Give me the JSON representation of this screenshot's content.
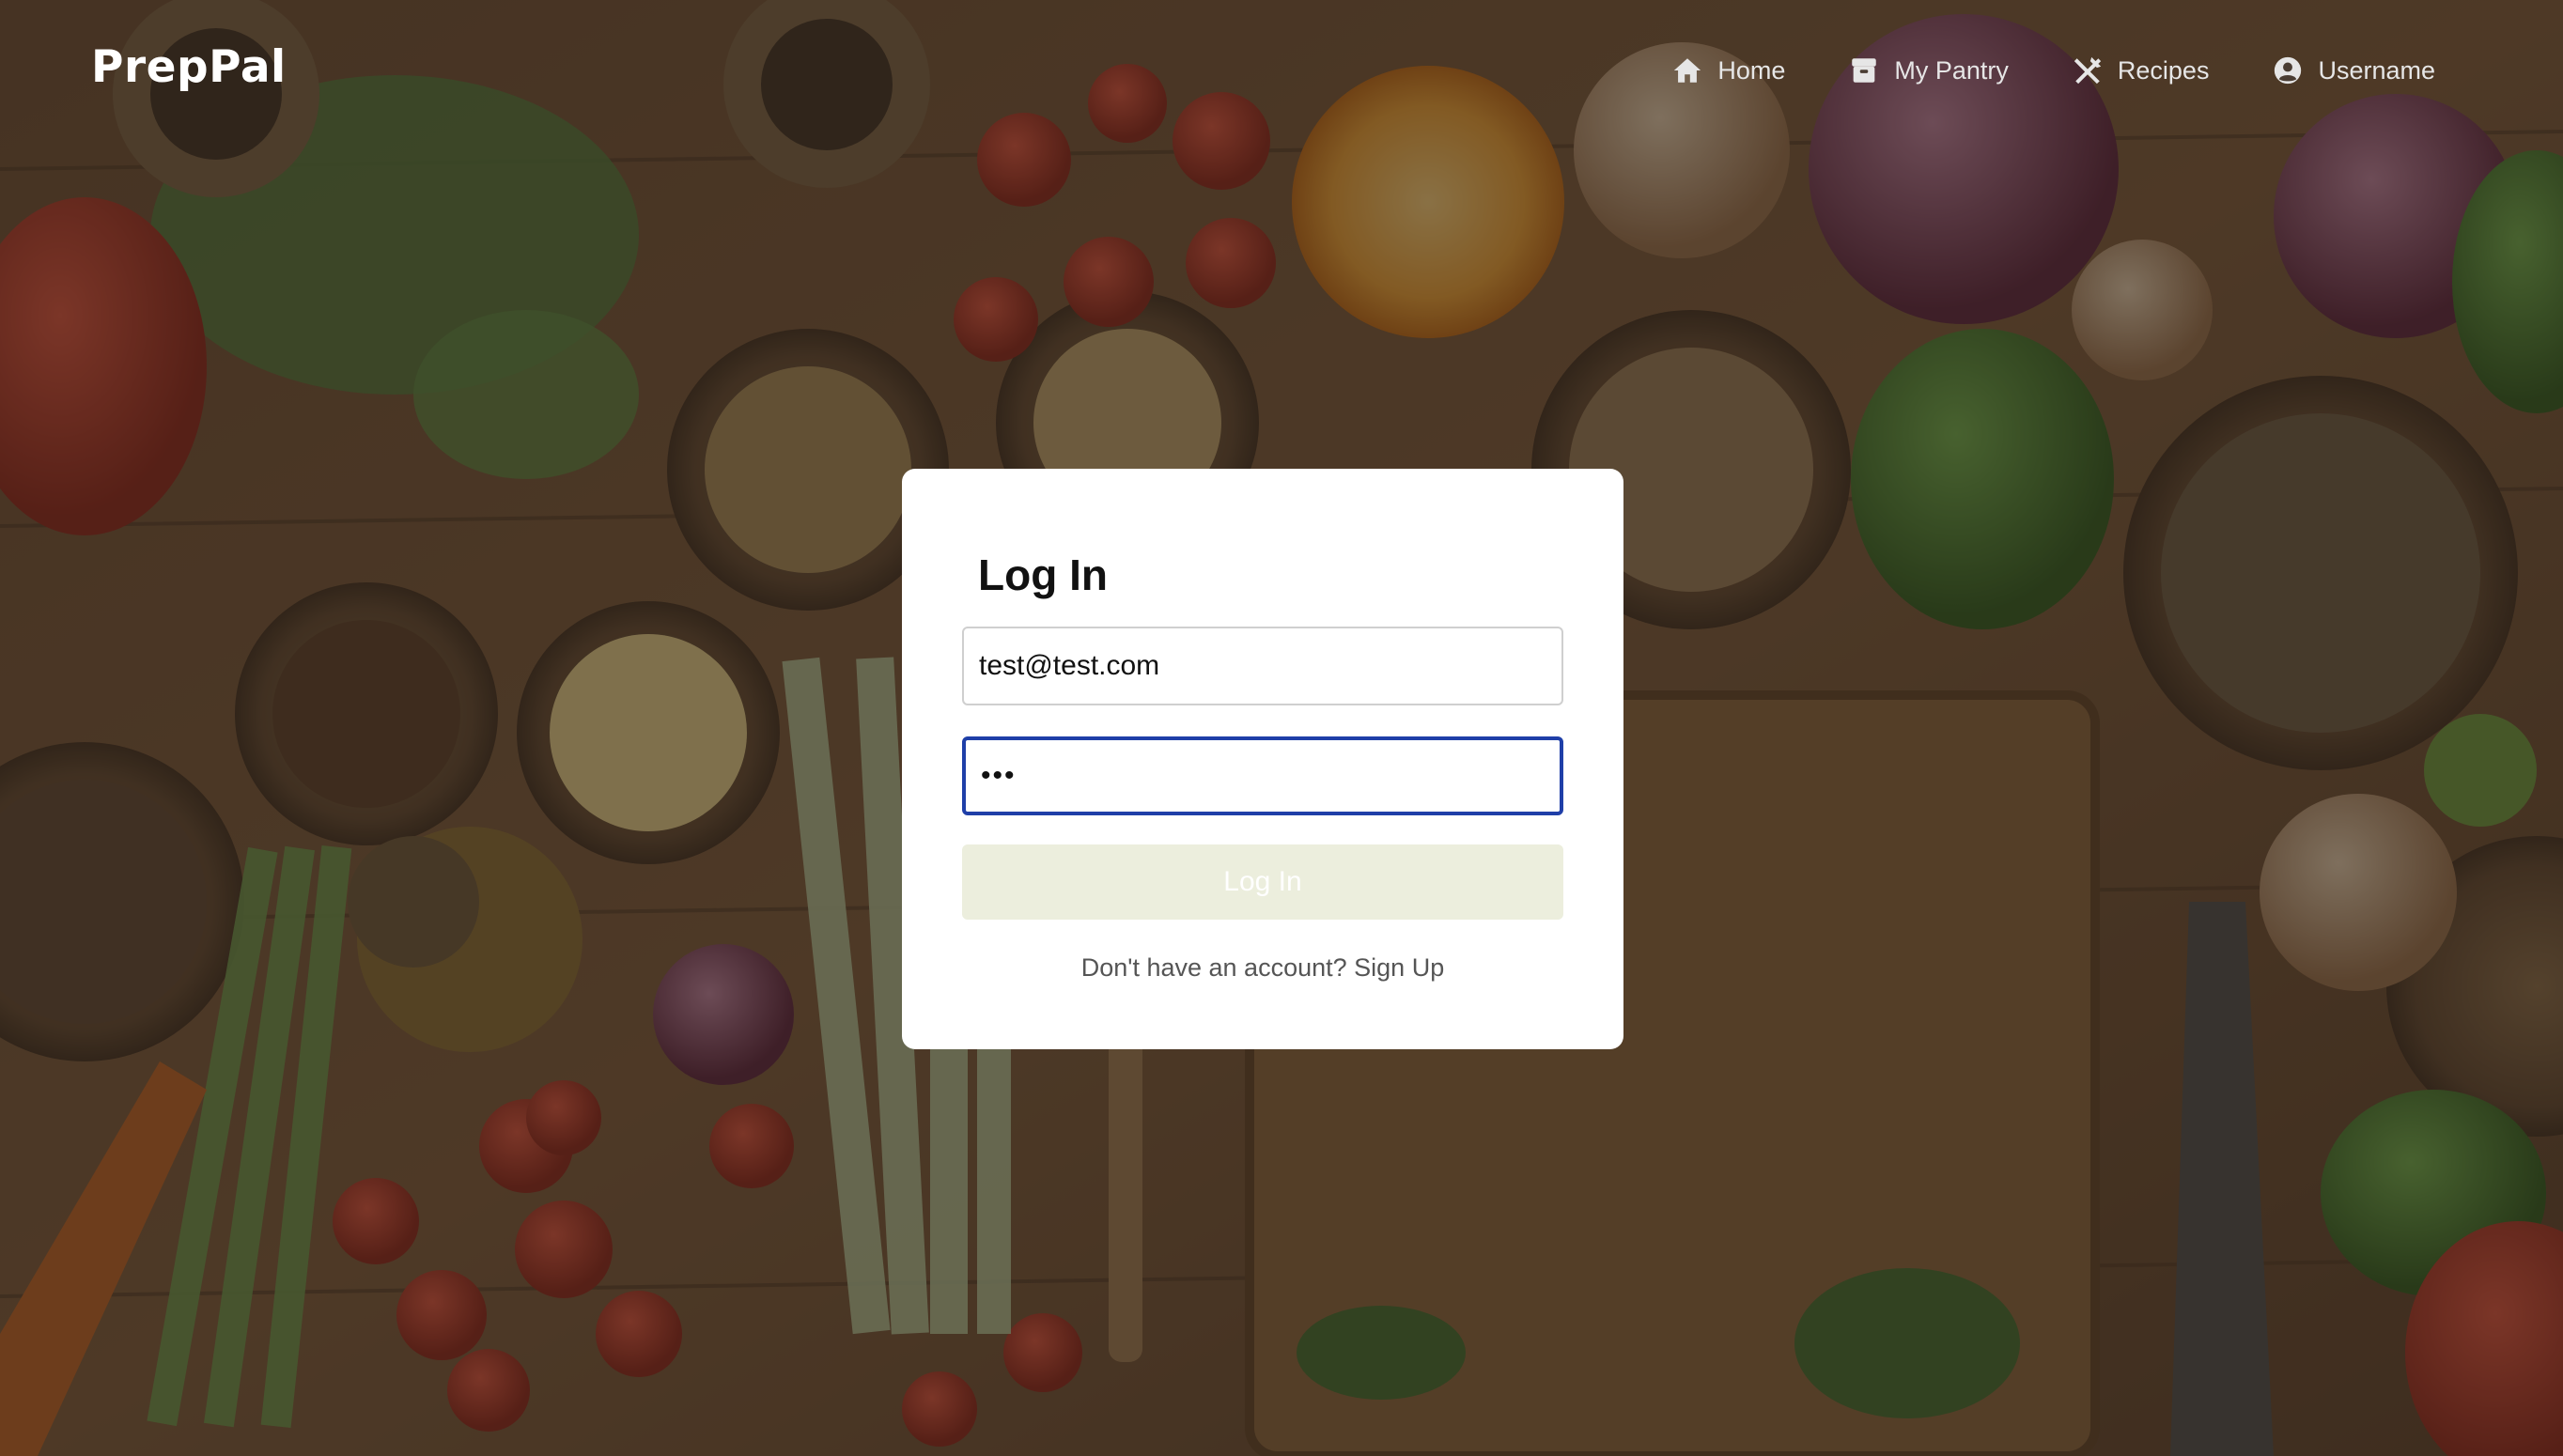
{
  "navbar": {
    "brand": "PrepPal",
    "links": [
      {
        "label": "Home",
        "icon": "home-icon"
      },
      {
        "label": "My Pantry",
        "icon": "pantry-icon"
      },
      {
        "label": "Recipes",
        "icon": "utensils-icon"
      },
      {
        "label": "Username",
        "icon": "user-circle-icon"
      }
    ]
  },
  "login": {
    "title": "Log In",
    "email_value": "test@test.com",
    "password_value": "•••",
    "submit_label": "Log In",
    "signup_prompt": "Don't have an account?",
    "signup_link": "Sign Up"
  },
  "colors": {
    "focus_border": "#1f3fa8",
    "submit_bg": "#eceedd",
    "overlay": "rgba(40,32,26,0.55)"
  }
}
